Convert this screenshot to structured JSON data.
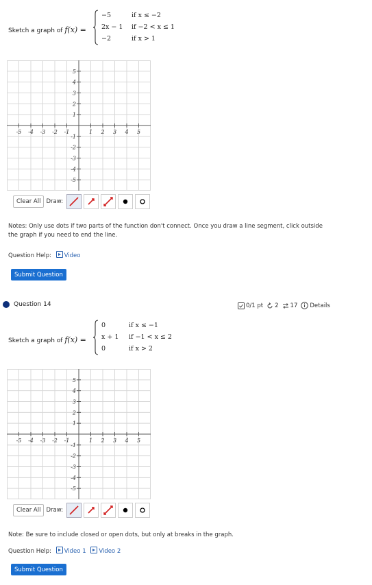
{
  "q13": {
    "prompt": "Sketch a graph of",
    "function_lhs": "f(x) =",
    "cases": [
      {
        "value": "−5",
        "condition": "if  x ≤ −2"
      },
      {
        "value": "2x − 1",
        "condition": "if  −2 < x ≤ 1"
      },
      {
        "value": "−2",
        "condition": "if  x > 1"
      }
    ],
    "clear_all": "Clear All",
    "draw_label": "Draw:",
    "note": "Notes: Only use dots if two parts of the function don't connect. Once you draw a line segment, click outside the graph if you need to end the line.",
    "help_label": "Question Help:",
    "videos": [
      "Video"
    ],
    "submit": "Submit Question"
  },
  "q14": {
    "title": "Question 14",
    "score": "0/1 pt",
    "retries": "2",
    "attempts": "17",
    "details": "Details",
    "prompt": "Sketch a graph of",
    "function_lhs": "f(x) =",
    "cases": [
      {
        "value": "0",
        "condition": "if  x ≤ −1"
      },
      {
        "value": "x + 1",
        "condition": "if  −1 < x ≤ 2"
      },
      {
        "value": "0",
        "condition": "if  x > 2"
      }
    ],
    "clear_all": "Clear All",
    "draw_label": "Draw:",
    "note": "Note: Be sure to include closed or open dots, but only at breaks in the graph.",
    "help_label": "Question Help:",
    "videos": [
      "Video 1",
      "Video 2"
    ],
    "submit": "Submit Question"
  },
  "graph_axis": {
    "x_ticks": [
      "-5",
      "-4",
      "-3",
      "-2",
      "-1",
      "1",
      "2",
      "3",
      "4",
      "5"
    ],
    "y_ticks": [
      "5",
      "4",
      "3",
      "2",
      "1",
      "-1",
      "-2",
      "-3",
      "-4",
      "-5"
    ],
    "xlim": [
      -6,
      6
    ],
    "ylim": [
      -6,
      6
    ]
  },
  "draw_tools": [
    "line-segment-icon",
    "ray-icon",
    "line-icon",
    "closed-dot-icon",
    "open-dot-icon"
  ],
  "colors": {
    "accent": "#1a6fd1",
    "grid": "#d8d8d8",
    "axis": "#555555",
    "tool_red": "#d22020",
    "question_dot": "#0d2f7a"
  }
}
